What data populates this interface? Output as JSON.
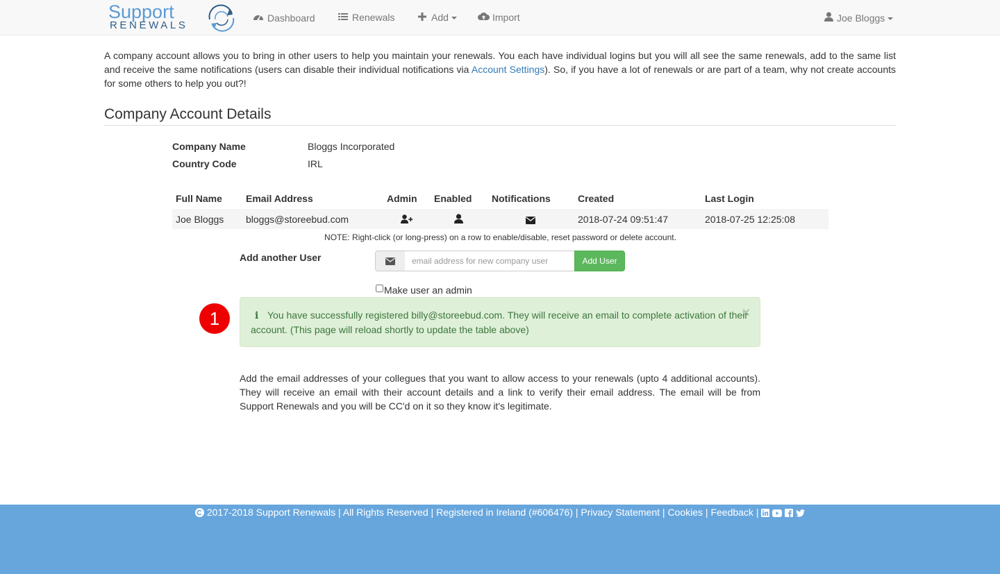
{
  "brand": {
    "word1": "Support",
    "word2": "RENEWALS",
    "colors": {
      "light": "#5b9bd5",
      "dark": "#2f5d86"
    }
  },
  "nav": {
    "dashboard": {
      "icon": "dashboard-icon",
      "label": "Dashboard"
    },
    "renewals": {
      "icon": "list-icon",
      "label": "Renewals"
    },
    "add": {
      "icon": "plus-icon",
      "label": "Add"
    },
    "import": {
      "icon": "cloud-upload-icon",
      "label": "Import"
    },
    "user": {
      "icon": "user-icon",
      "label": "Joe Bloggs"
    }
  },
  "intro": {
    "before_link": "A company account allows you to bring in other users to help you maintain your renewals. You each have individual logins but you will all see the same renewals, add to the same list and receive the same notifications (users can disable their individual notifications via ",
    "link": "Account Settings",
    "after_link": "). So, if you have a lot of renewals or are part of a team, why not create accounts for some others to help you out?!"
  },
  "section_title": "Company Account Details",
  "details": {
    "company_name_label": "Company Name",
    "company_name": "Bloggs Incorporated",
    "country_code_label": "Country Code",
    "country_code": "IRL"
  },
  "users_table": {
    "headers": {
      "full_name": "Full Name",
      "email": "Email Address",
      "admin": "Admin",
      "enabled": "Enabled",
      "notifications": "Notifications",
      "created": "Created",
      "last_login": "Last Login"
    },
    "rows": [
      {
        "full_name": "Joe Bloggs",
        "email": "bloggs@storeebud.com",
        "admin_icon": "user-plus-icon",
        "enabled_icon": "user-icon",
        "notifications_icon": "envelope-icon",
        "created": "2018-07-24 09:51:47",
        "last_login": "2018-07-25 12:25:08"
      }
    ],
    "note": "NOTE: Right-click (or long-press) on a row to enable/disable, reset password or delete account."
  },
  "add_user": {
    "label": "Add another User",
    "placeholder": "email address for new company user",
    "value": "",
    "button": "Add User",
    "admin_checkbox_label": "Make user an admin",
    "admin_checked": false
  },
  "annotation_badge": "1",
  "alert": {
    "message": "You have successfully registered billy@storeebud.com. They will receive an email to complete activation of their account. (This page will reload shortly to update the table above)",
    "close": "×",
    "color": "#3c763d",
    "background": "#dff0d8"
  },
  "help_text": "Add the email addresses of your collegues that you want to allow access to your renewals (upto 4 additional accounts). They will receive an email with their account details and a link to verify their email address. The email will be from Support Renewals and you will be CC'd on it so they know it's legitimate.",
  "footer": {
    "copyright": "2017-2018 Support Renewals | All Rights Reserved | Registered in Ireland (#606476) |",
    "privacy": "Privacy Statement",
    "sep1": "|",
    "cookies": "Cookies",
    "sep2": "|",
    "feedback": "Feedback",
    "sep3": "|",
    "social_icons": [
      "linkedin-icon",
      "youtube-icon",
      "facebook-icon",
      "twitter-icon"
    ],
    "background": "#67a6dd"
  }
}
